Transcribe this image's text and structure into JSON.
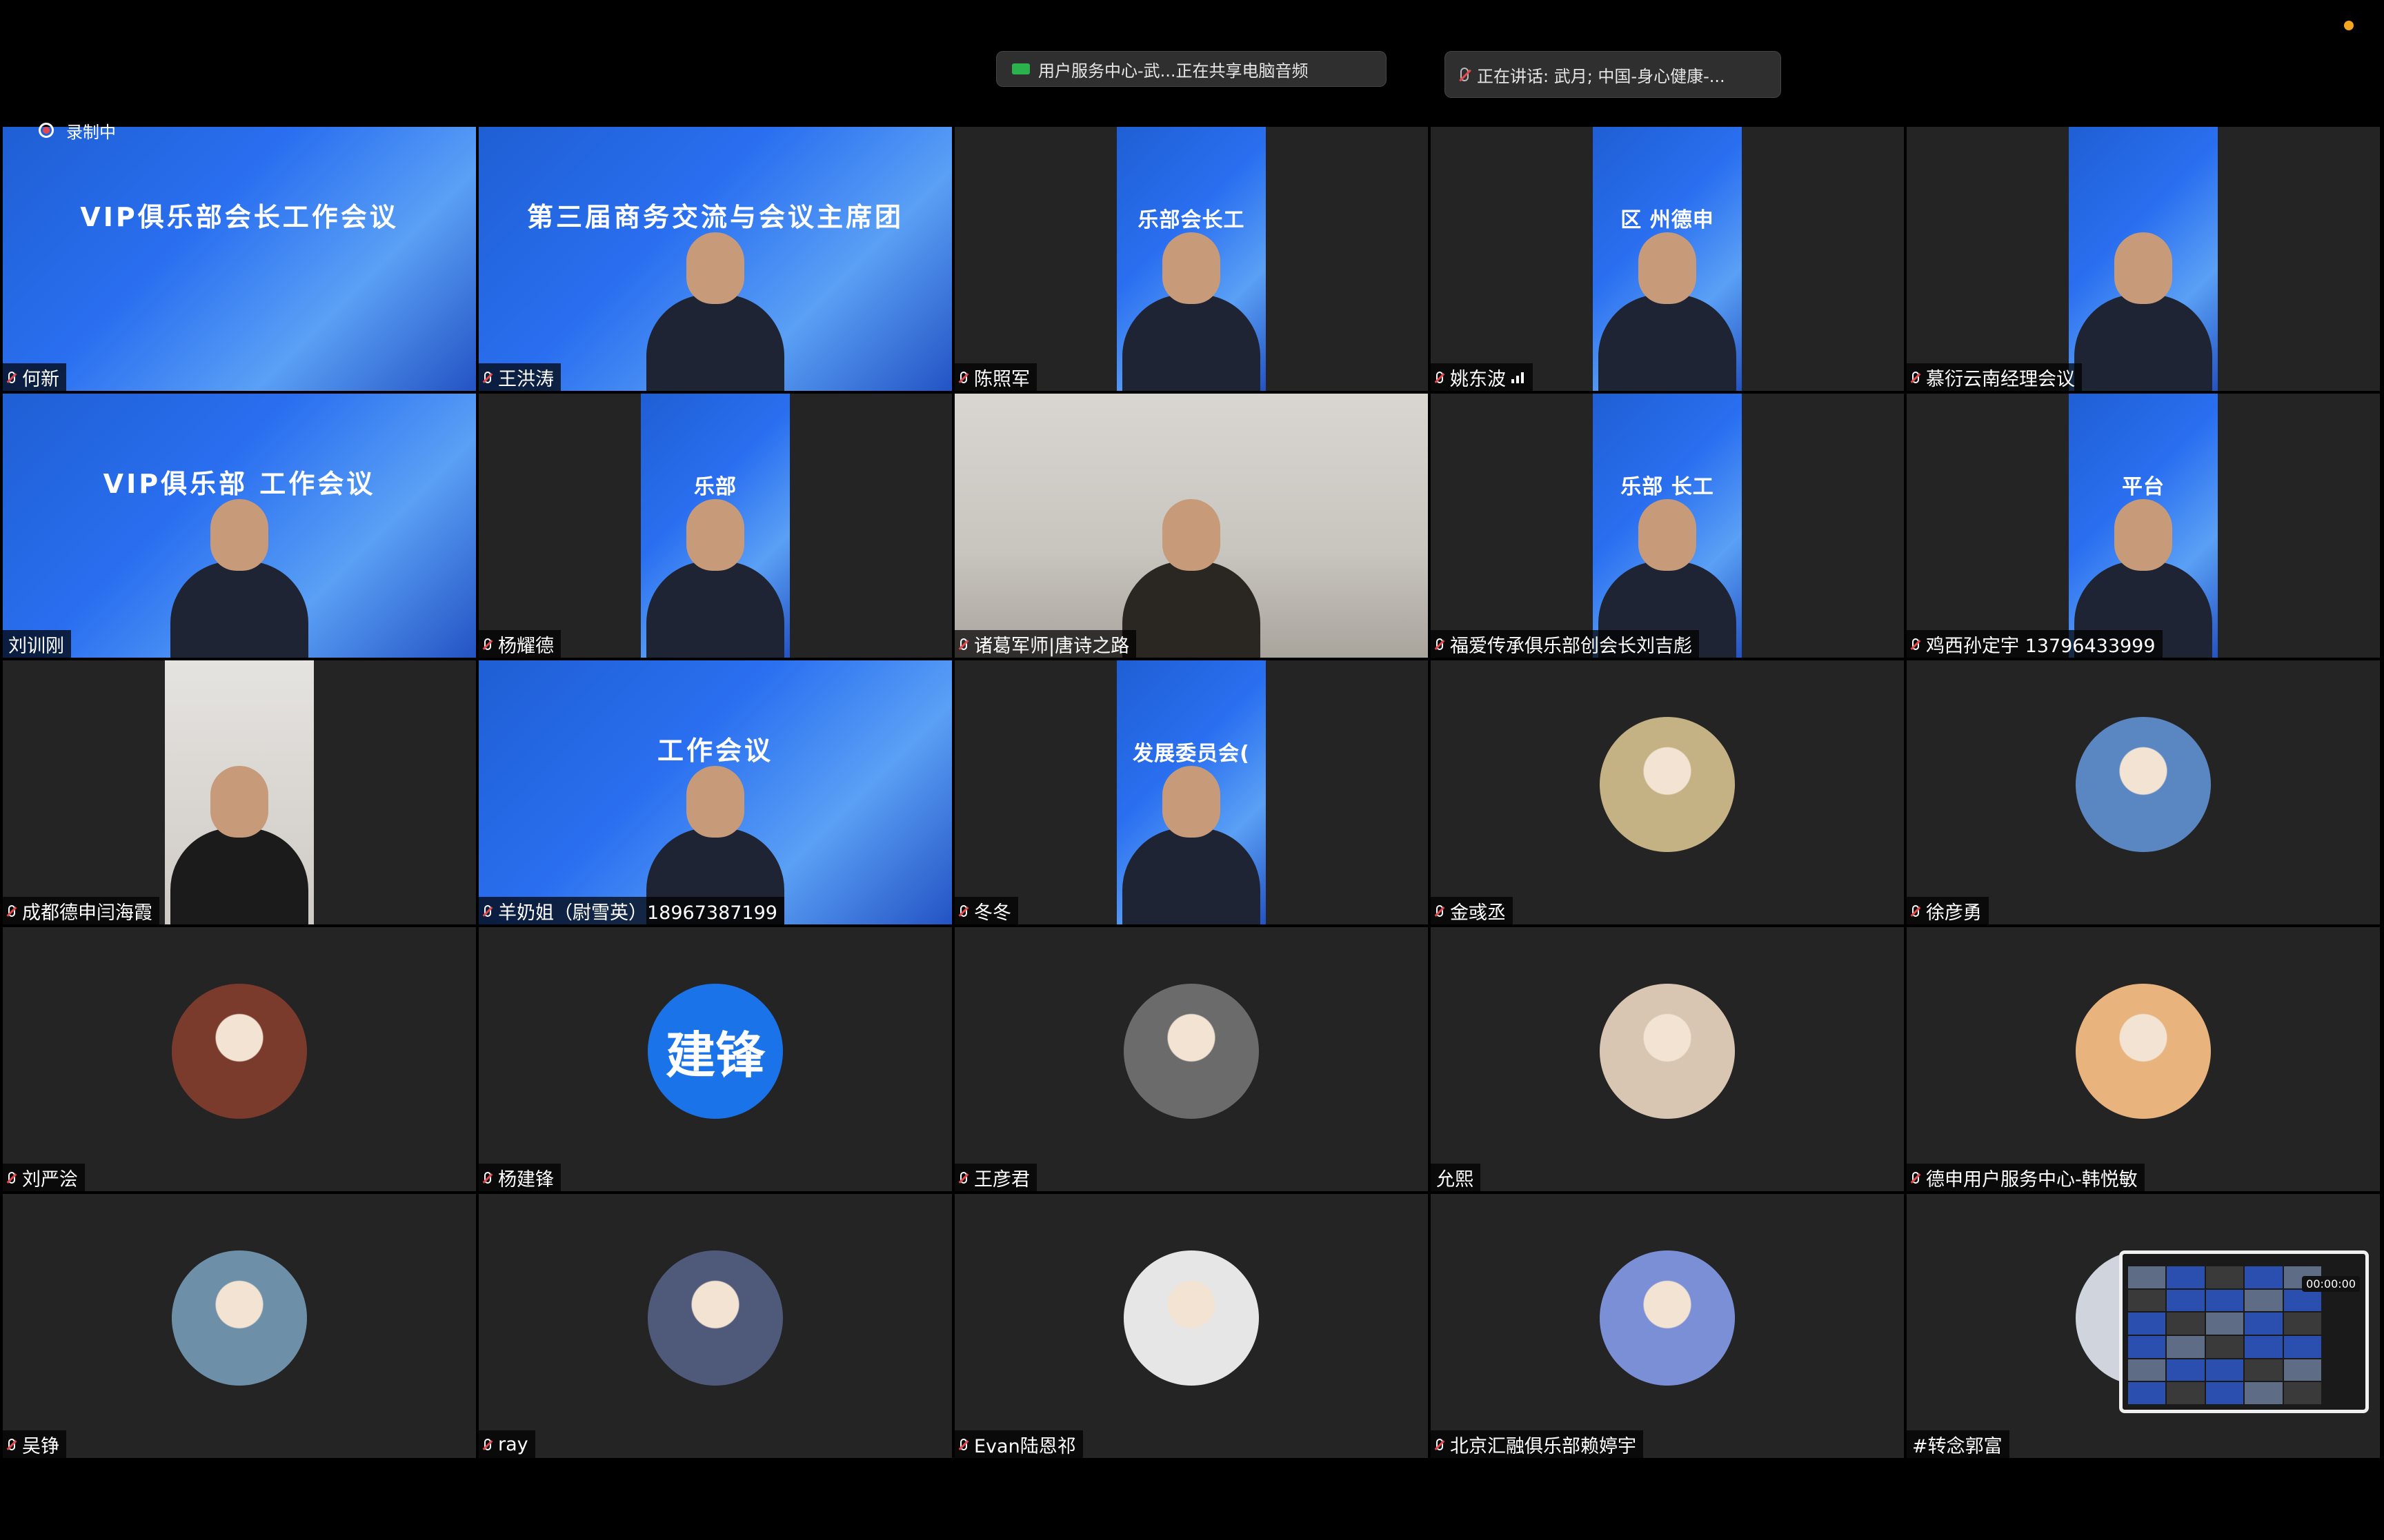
{
  "status_bar": {
    "share_label": "用户服务中心-武...正在共享电脑音频",
    "talking_label": "正在讲话: 武月; 中国-身心健康-...",
    "recording_label": "录制中"
  },
  "mini_view": {
    "timer": "00:00:00"
  },
  "tiles": [
    {
      "name": "何新",
      "kind": "slide",
      "slide": "VIP俱乐部会长工作会议",
      "mic": "muted",
      "icons": []
    },
    {
      "name": "王洪涛",
      "kind": "slide-person",
      "slide": "第三届商务交流与会议主席团",
      "mic": "muted",
      "icons": []
    },
    {
      "name": "陈照军",
      "kind": "portrait",
      "slide": "乐部会长工",
      "mic": "muted",
      "icons": []
    },
    {
      "name": "姚东波",
      "kind": "portrait",
      "slide": "区  州德申",
      "mic": "muted",
      "icons": [
        "signal-icon"
      ]
    },
    {
      "name": "慕衍云南经理会议",
      "kind": "portrait",
      "slide": "",
      "mic": "muted",
      "icons": []
    },
    {
      "name": "刘训刚",
      "kind": "slide-person",
      "slide": "VIP俱乐部 工作会议",
      "mic": "none",
      "icons": []
    },
    {
      "name": "杨耀德",
      "kind": "portrait",
      "slide": "乐部",
      "mic": "muted",
      "icons": []
    },
    {
      "name": "诸葛军师|唐诗之路",
      "kind": "room",
      "slide": "",
      "mic": "muted",
      "icons": []
    },
    {
      "name": "福爱传承俱乐部创会长刘吉彪",
      "kind": "portrait",
      "slide": "乐部 长工",
      "mic": "muted",
      "icons": []
    },
    {
      "name": "鸡西孙定宇 13796433999",
      "kind": "portrait",
      "slide": "平台",
      "mic": "muted",
      "icons": []
    },
    {
      "name": "成都德申闫海霞",
      "kind": "portrait-light",
      "slide": "",
      "mic": "muted",
      "icons": []
    },
    {
      "name": "羊奶姐（尉雪英）18967387199",
      "kind": "slide-person",
      "slide": "工作会议",
      "mic": "muted",
      "icons": []
    },
    {
      "name": "冬冬",
      "kind": "portrait",
      "slide": "发展委员会(",
      "mic": "muted",
      "icons": []
    },
    {
      "name": "金彧丞",
      "kind": "avatar",
      "avatar_color": "#c4b184",
      "mic": "muted",
      "icons": []
    },
    {
      "name": "徐彦勇",
      "kind": "avatar",
      "avatar_color": "#5a86c2",
      "mic": "muted",
      "icons": []
    },
    {
      "name": "刘严浍",
      "kind": "avatar",
      "avatar_color": "#7a3a2c",
      "mic": "muted",
      "icons": []
    },
    {
      "name": "杨建锋",
      "kind": "avatar-text",
      "avatar_text": "建锋",
      "mic": "muted",
      "icons": []
    },
    {
      "name": "王彦君",
      "kind": "avatar",
      "avatar_color": "#6b6b6b",
      "mic": "muted",
      "icons": []
    },
    {
      "name": "允熙",
      "kind": "avatar",
      "avatar_color": "#d9c6b2",
      "mic": "none",
      "icons": []
    },
    {
      "name": "德申用户服务中心-韩悦敏",
      "kind": "avatar",
      "avatar_color": "#e9b37e",
      "mic": "muted",
      "icons": []
    },
    {
      "name": "吴铮",
      "kind": "avatar",
      "avatar_color": "#6d8fa8",
      "mic": "muted",
      "icons": []
    },
    {
      "name": "ray",
      "kind": "avatar",
      "avatar_color": "#4f5a7a",
      "mic": "muted",
      "icons": []
    },
    {
      "name": "Evan陆恩祁",
      "kind": "avatar",
      "avatar_color": "#e6e6e6",
      "mic": "muted",
      "icons": []
    },
    {
      "name": "北京汇融俱乐部赖婷宇",
      "kind": "avatar",
      "avatar_color": "#7b8fd6",
      "mic": "muted",
      "icons": []
    },
    {
      "name": "#转念郭富",
      "kind": "avatar",
      "avatar_color": "#cfd4dd",
      "mic": "none",
      "icons": []
    }
  ],
  "colors": {
    "accent_blue": "#1a73e8",
    "share_green": "#2bb24c",
    "muted_red": "#e5484d"
  }
}
